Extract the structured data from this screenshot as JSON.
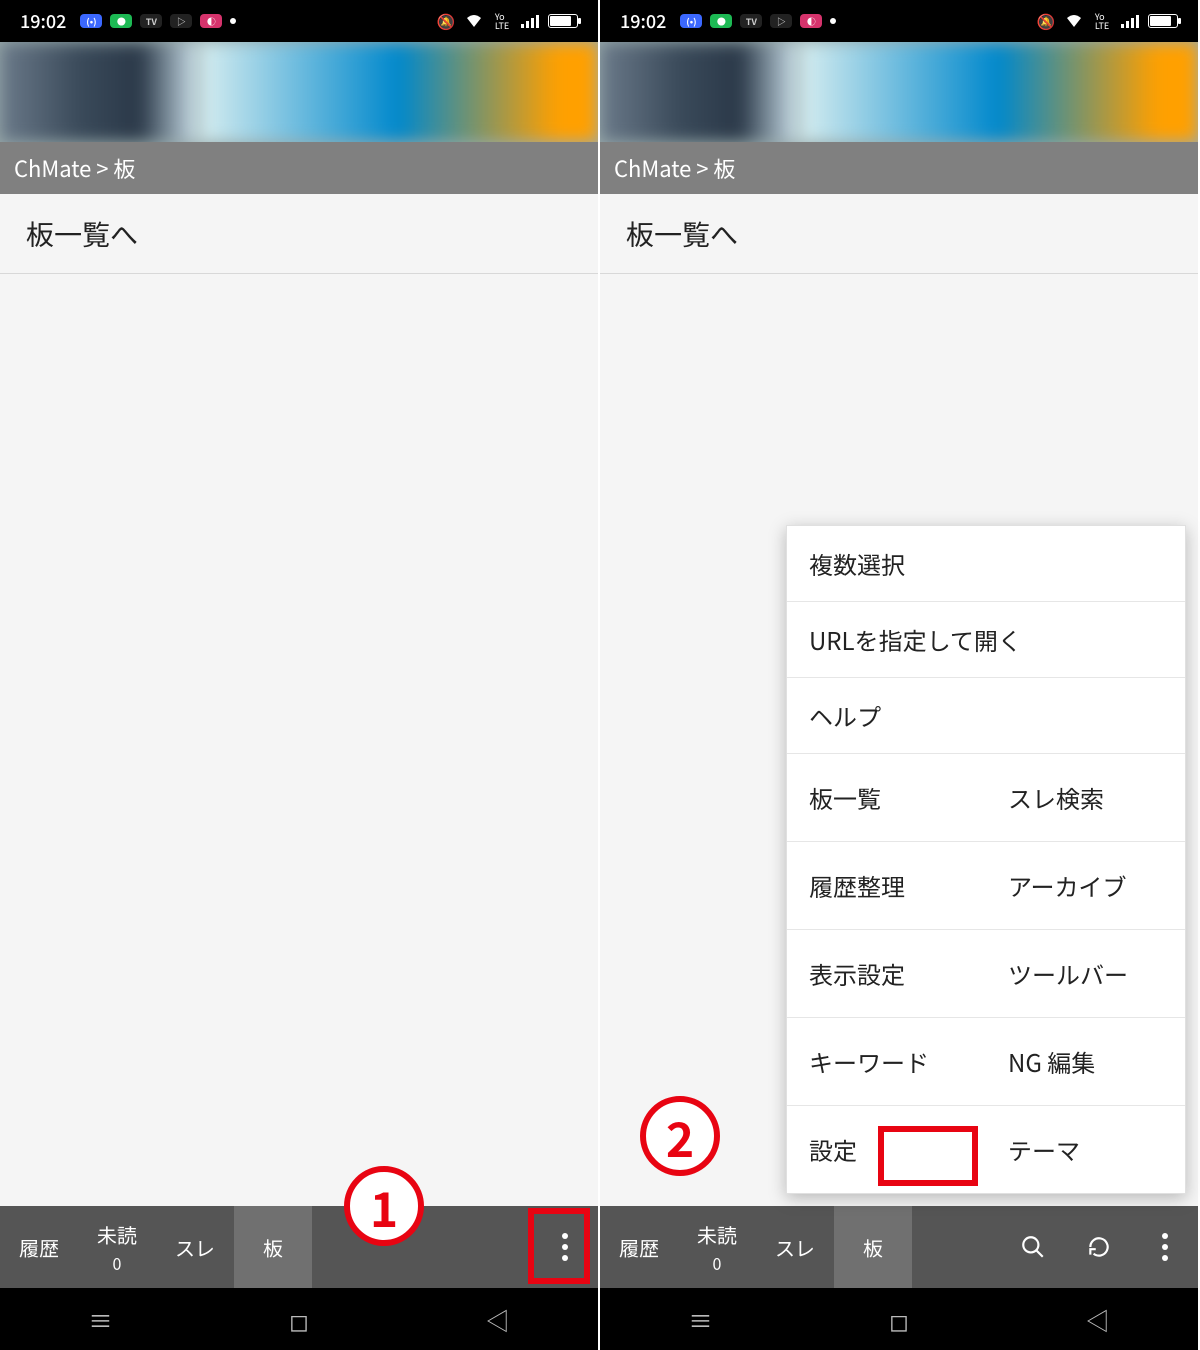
{
  "statusbar": {
    "time": "19:02",
    "right": {
      "mute": "🔕",
      "wifi": "📶",
      "lte": "Yo LTE",
      "signal": "▮▮▮▮",
      "battery": "75%"
    }
  },
  "breadcrumb": "ChMate > 板",
  "list": {
    "item0": "板一覧へ"
  },
  "tabs": {
    "history": "履歴",
    "unread": "未読",
    "unread_count": "0",
    "thread": "スレ",
    "board": "板"
  },
  "menu": {
    "multi_select": "複数選択",
    "open_url": "URLを指定して開く",
    "help": "ヘルプ",
    "board_list": "板一覧",
    "thread_search": "スレ検索",
    "history_cleanup": "履歴整理",
    "archive": "アーカイブ",
    "display_settings": "表示設定",
    "toolbar": "ツールバー",
    "keyword": "キーワード",
    "ng_edit": "NG 編集",
    "settings": "設定",
    "theme": "テーマ"
  },
  "annotations": {
    "step1": "1",
    "step2": "2"
  }
}
